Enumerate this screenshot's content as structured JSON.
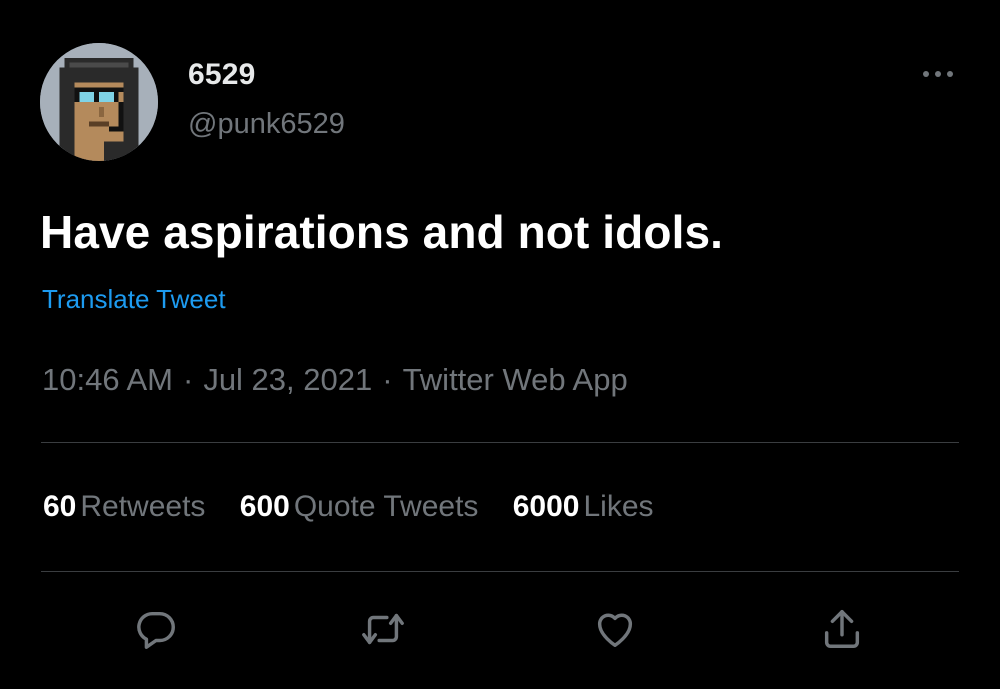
{
  "user": {
    "display_name": "6529",
    "handle": "@punk6529",
    "avatar_icon": "cryptopunk-avatar-icon"
  },
  "tweet": {
    "text": "Have aspirations and not idols.",
    "translate_label": "Translate Tweet",
    "time": "10:46 AM",
    "date": "Jul 23, 2021",
    "source": "Twitter Web App",
    "separator": "·"
  },
  "stats": {
    "retweets": {
      "count": "60",
      "label": "Retweets"
    },
    "quotes": {
      "count": "600",
      "label": "Quote Tweets"
    },
    "likes": {
      "count": "6000",
      "label": "Likes"
    }
  },
  "actions": [
    {
      "icon": "reply-icon"
    },
    {
      "icon": "retweet-icon"
    },
    {
      "icon": "like-icon"
    },
    {
      "icon": "share-icon"
    }
  ],
  "colors": {
    "background": "#000000",
    "text_primary": "#e7e9ea",
    "text_secondary": "#71767b",
    "link": "#1d9bf0",
    "divider": "#3a3d40"
  }
}
